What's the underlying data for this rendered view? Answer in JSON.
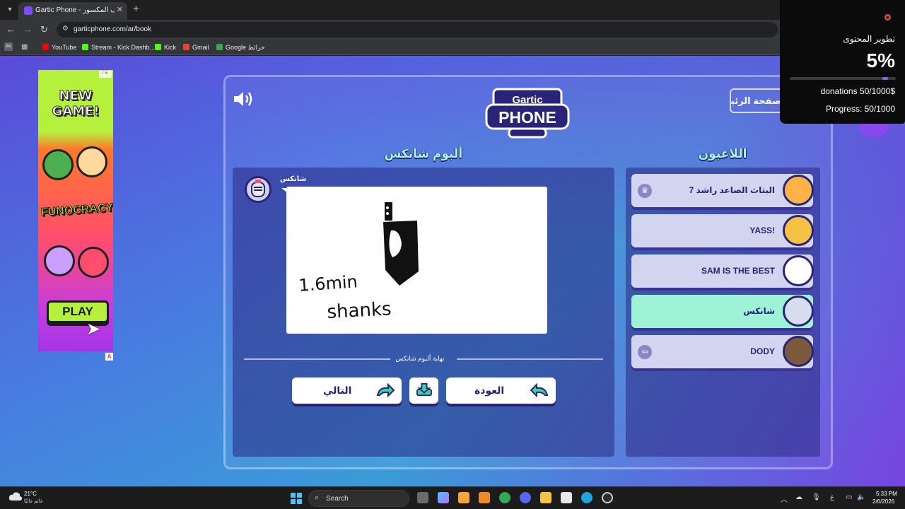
{
  "browser": {
    "tab_title": "Gartic Phone - الهاتف المكسور",
    "tab_close": "✕",
    "new_tab": "+",
    "url": "garticphone.com/ar/book",
    "nav": {
      "back": "←",
      "forward": "→",
      "reload": "↻"
    },
    "bookmarks": [
      {
        "label": "YouTube",
        "color": "#ff0000"
      },
      {
        "label": "Stream - Kick Dashb...",
        "color": "#53fc18"
      },
      {
        "label": "Kick",
        "color": "#53fc18"
      },
      {
        "label": "Gmail",
        "color": "#ea4335"
      },
      {
        "label": "Google خرائط",
        "color": "#34a853"
      }
    ],
    "apps_label": "as"
  },
  "ad": {
    "title": "NEW GAME!",
    "logo": "FUNOCRACY",
    "play_label": "PLAY",
    "badge": "i ✕",
    "choice": "A"
  },
  "game": {
    "logo_line1": "Gartic",
    "logo_line2": "PHONE",
    "home_label": "الصفحة الرئيسية",
    "players_title": "اللاعبون",
    "album_title": "ألبوم شانكس",
    "album_author": "شانكس",
    "drawing_text_1": "1.6min",
    "drawing_text_2": "shanks",
    "end_label": "نهاية ألبوم شانكس",
    "next_label": "التالي",
    "back_label": "العودة",
    "players": [
      {
        "name": "البثاث الصاعد راشد 7",
        "badge": "♛",
        "active": false,
        "avatar_color": "#ffb347"
      },
      {
        "name": "!YASS",
        "badge": "",
        "active": false,
        "avatar_color": "#f6c244"
      },
      {
        "name": "SAM IS THE BEST",
        "badge": "",
        "active": false,
        "avatar_color": "#ffffff"
      },
      {
        "name": "شانكس",
        "badge": "",
        "active": true,
        "avatar_color": "#d8dcef"
      },
      {
        "name": "DODY",
        "badge": "⇦",
        "active": false,
        "avatar_color": "#7a5a3a"
      }
    ]
  },
  "overlay": {
    "title": "تطوير المحتوى",
    "percent": "5%",
    "progress_fraction": 0.05,
    "donations": "donations 50/1000$",
    "progress": "Progress: 50/1000"
  },
  "taskbar": {
    "temp": "21°C",
    "weather": "غائم غالبًا",
    "search_label": "Search",
    "lang": "ع",
    "time": "5:33 PM",
    "date": "2/6/2026"
  }
}
